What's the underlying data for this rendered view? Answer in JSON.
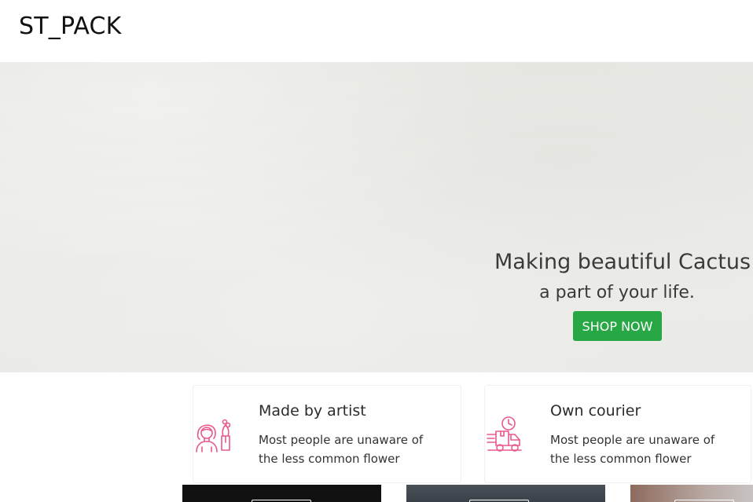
{
  "header": {
    "brand": "ST_PACK"
  },
  "hero": {
    "heading": "Making beautiful Cactus",
    "subheading": "a part of your life.",
    "button_label": "SHOP NOW",
    "button_color": "#28a745",
    "background_color": "#ebebe8"
  },
  "features": [
    {
      "title": "Made by artist",
      "desc_line1": "Most people are unaware of",
      "desc_line2": "the less common flower",
      "icon": "artist-with-flowers-icon"
    },
    {
      "title": "Own courier",
      "desc_line1": "Most people are unaware of",
      "desc_line2": "the less common flower",
      "icon": "courier-delivery-icon"
    }
  ],
  "colors": {
    "icon_accent": "#e8588f",
    "accent_green": "#28a745"
  }
}
